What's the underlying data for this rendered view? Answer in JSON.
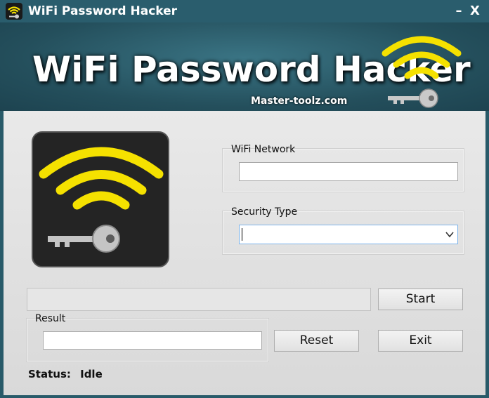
{
  "window": {
    "title": "WiFi Password Hacker",
    "minimize_symbol": "–",
    "close_symbol": "X",
    "app_icon": "wifi-key-icon"
  },
  "banner": {
    "title": "WiFi Password Hacker",
    "subtitle": "Master-toolz.com",
    "logo_icon": "wifi-key-icon"
  },
  "logo": {
    "icon": "wifi-key-icon"
  },
  "form": {
    "network_label": "WiFi Network",
    "network_value": "",
    "security_label": "Security Type",
    "security_value": "",
    "result_label": "Result",
    "result_value": ""
  },
  "progress": {
    "value": 0
  },
  "buttons": {
    "start": "Start",
    "reset": "Reset",
    "exit": "Exit"
  },
  "status": {
    "label": "Status:",
    "value": "Idle"
  },
  "colors": {
    "accent_yellow": "#f5e100",
    "titlebar": "#2a5d6d",
    "panel": "#e2e2e2"
  }
}
